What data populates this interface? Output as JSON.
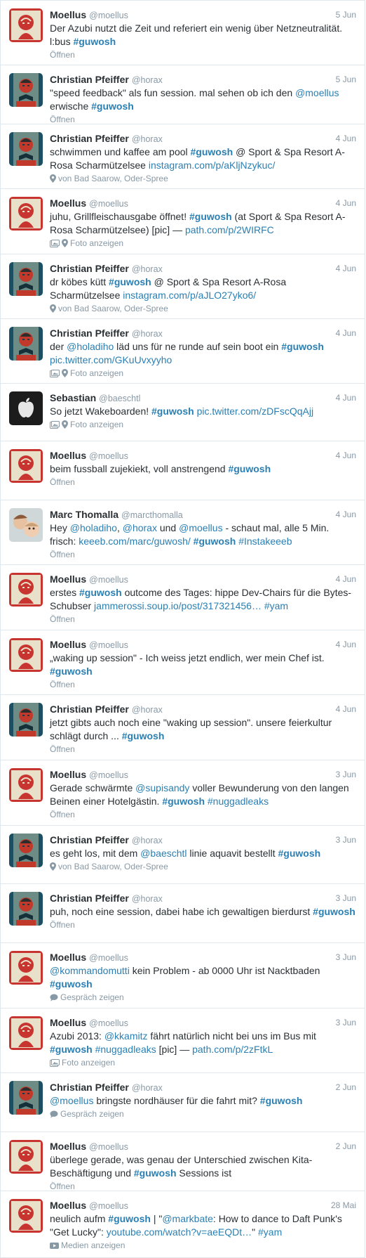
{
  "tweets": [
    {
      "name": "Moellus",
      "handle": "@moellus",
      "date": "5 Jun",
      "avatar": "obey-poster-avatar",
      "meta": {
        "icons": [],
        "label": "Öffnen"
      },
      "segments": [
        {
          "t": "text",
          "v": "Der Azubi nutzt die Zeit und referiert ein wenig über Netzneutralität. l:bus "
        },
        {
          "t": "hash",
          "v": "#guwosh"
        }
      ]
    },
    {
      "name": "Christian Pfeiffer",
      "handle": "@horax",
      "date": "5 Jun",
      "avatar": "bowtie-poster-avatar",
      "meta": {
        "icons": [],
        "label": "Öffnen"
      },
      "segments": [
        {
          "t": "text",
          "v": "\"speed feedback\" als fun session. mal sehen ob ich den "
        },
        {
          "t": "link",
          "v": "@moellus"
        },
        {
          "t": "text",
          "v": " erwische "
        },
        {
          "t": "hash",
          "v": "#guwosh"
        }
      ]
    },
    {
      "name": "Christian Pfeiffer",
      "handle": "@horax",
      "date": "4 Jun",
      "avatar": "bowtie-poster-avatar",
      "meta": {
        "icons": [
          "location-pin-icon"
        ],
        "label": "von Bad Saarow, Oder-Spree"
      },
      "segments": [
        {
          "t": "text",
          "v": "schwimmen und kaffee am pool "
        },
        {
          "t": "hash",
          "v": "#guwosh"
        },
        {
          "t": "text",
          "v": " @ Sport & Spa Resort A-Rosa Scharmützelsee "
        },
        {
          "t": "link",
          "v": "instagram.com/p/aKljNzykuc/"
        }
      ]
    },
    {
      "name": "Moellus",
      "handle": "@moellus",
      "date": "4 Jun",
      "avatar": "obey-poster-avatar",
      "meta": {
        "icons": [
          "photo-icon",
          "location-pin-icon"
        ],
        "label": "Foto anzeigen"
      },
      "segments": [
        {
          "t": "text",
          "v": "juhu, Grillfleischausgabe öffnet! "
        },
        {
          "t": "hash",
          "v": "#guwosh"
        },
        {
          "t": "text",
          "v": " (at Sport & Spa Resort A-Rosa Scharmützelsee) [pic] — "
        },
        {
          "t": "link",
          "v": "path.com/p/2WIRFC"
        }
      ]
    },
    {
      "name": "Christian Pfeiffer",
      "handle": "@horax",
      "date": "4 Jun",
      "avatar": "bowtie-poster-avatar",
      "meta": {
        "icons": [
          "location-pin-icon"
        ],
        "label": "von Bad Saarow, Oder-Spree"
      },
      "segments": [
        {
          "t": "text",
          "v": "dr köbes kütt "
        },
        {
          "t": "hash",
          "v": "#guwosh"
        },
        {
          "t": "text",
          "v": " @ Sport & Spa Resort A-Rosa Scharmützelsee "
        },
        {
          "t": "link",
          "v": "instagram.com/p/aJLO27yko6/"
        }
      ]
    },
    {
      "name": "Christian Pfeiffer",
      "handle": "@horax",
      "date": "4 Jun",
      "avatar": "bowtie-poster-avatar",
      "meta": {
        "icons": [
          "photo-icon",
          "location-pin-icon"
        ],
        "label": "Foto anzeigen"
      },
      "segments": [
        {
          "t": "text",
          "v": "der "
        },
        {
          "t": "link",
          "v": "@holadiho"
        },
        {
          "t": "text",
          "v": " läd uns für ne runde auf sein boot ein "
        },
        {
          "t": "hash",
          "v": "#guwosh"
        },
        {
          "t": "text",
          "v": " "
        },
        {
          "t": "link",
          "v": "pic.twitter.com/GKuUvxyyho"
        }
      ]
    },
    {
      "name": "Sebastian",
      "handle": "@baeschtl",
      "date": "4 Jun",
      "avatar": "apple-logo-avatar",
      "meta": {
        "icons": [
          "photo-icon",
          "location-pin-icon"
        ],
        "label": "Foto anzeigen"
      },
      "segments": [
        {
          "t": "text",
          "v": "So jetzt Wakeboarden! "
        },
        {
          "t": "hash",
          "v": "#guwosh"
        },
        {
          "t": "text",
          "v": " "
        },
        {
          "t": "link",
          "v": "pic.twitter.com/zDFscQqAjj"
        }
      ]
    },
    {
      "name": "Moellus",
      "handle": "@moellus",
      "date": "4 Jun",
      "avatar": "obey-poster-avatar",
      "meta": {
        "icons": [],
        "label": "Öffnen"
      },
      "segments": [
        {
          "t": "text",
          "v": "beim fussball zujekiekt, voll anstrengend "
        },
        {
          "t": "hash",
          "v": "#guwosh"
        }
      ]
    },
    {
      "name": "Marc Thomalla",
      "handle": "@marcthomalla",
      "date": "4 Jun",
      "avatar": "family-photo-avatar",
      "meta": {
        "icons": [],
        "label": "Öffnen"
      },
      "segments": [
        {
          "t": "text",
          "v": "Hey "
        },
        {
          "t": "link",
          "v": "@holadiho"
        },
        {
          "t": "text",
          "v": ", "
        },
        {
          "t": "link",
          "v": "@horax"
        },
        {
          "t": "text",
          "v": " und "
        },
        {
          "t": "link",
          "v": "@moellus"
        },
        {
          "t": "text",
          "v": " - schaut mal, alle 5 Min. frisch: "
        },
        {
          "t": "link",
          "v": "keeeb.com/marc/guwosh/"
        },
        {
          "t": "text",
          "v": " "
        },
        {
          "t": "hash",
          "v": "#guwosh"
        },
        {
          "t": "text",
          "v": " "
        },
        {
          "t": "link",
          "v": "#Instakeeeb"
        }
      ]
    },
    {
      "name": "Moellus",
      "handle": "@moellus",
      "date": "4 Jun",
      "avatar": "obey-poster-avatar",
      "meta": {
        "icons": [],
        "label": "Öffnen"
      },
      "segments": [
        {
          "t": "text",
          "v": "erstes "
        },
        {
          "t": "hash",
          "v": "#guwosh"
        },
        {
          "t": "text",
          "v": " outcome des Tages: hippe Dev-Chairs für die Bytes-Schubser "
        },
        {
          "t": "link",
          "v": "jammerossi.soup.io/post/317321456…"
        },
        {
          "t": "text",
          "v": " "
        },
        {
          "t": "link",
          "v": "#yam"
        }
      ]
    },
    {
      "name": "Moellus",
      "handle": "@moellus",
      "date": "4 Jun",
      "avatar": "obey-poster-avatar",
      "meta": {
        "icons": [],
        "label": "Öffnen"
      },
      "segments": [
        {
          "t": "text",
          "v": "„waking up session\" - Ich weiss jetzt endlich, wer mein Chef ist. "
        },
        {
          "t": "hash",
          "v": "#guwosh"
        }
      ]
    },
    {
      "name": "Christian Pfeiffer",
      "handle": "@horax",
      "date": "4 Jun",
      "avatar": "bowtie-poster-avatar",
      "meta": {
        "icons": [],
        "label": "Öffnen"
      },
      "segments": [
        {
          "t": "text",
          "v": "jetzt gibts auch noch eine \"waking up session\". unsere feierkultur schlägt durch ... "
        },
        {
          "t": "hash",
          "v": "#guwosh"
        }
      ]
    },
    {
      "name": "Moellus",
      "handle": "@moellus",
      "date": "3 Jun",
      "avatar": "obey-poster-avatar",
      "meta": {
        "icons": [],
        "label": "Öffnen"
      },
      "segments": [
        {
          "t": "text",
          "v": "Gerade schwärmte "
        },
        {
          "t": "link",
          "v": "@supisandy"
        },
        {
          "t": "text",
          "v": " voller Bewunderung von den langen Beinen einer Hotelgästin. "
        },
        {
          "t": "hash",
          "v": "#guwosh"
        },
        {
          "t": "text",
          "v": " "
        },
        {
          "t": "link",
          "v": "#nuggadleaks"
        }
      ]
    },
    {
      "name": "Christian Pfeiffer",
      "handle": "@horax",
      "date": "3 Jun",
      "avatar": "bowtie-poster-avatar",
      "meta": {
        "icons": [
          "location-pin-icon"
        ],
        "label": "von Bad Saarow, Oder-Spree"
      },
      "segments": [
        {
          "t": "text",
          "v": "es geht los, mit dem "
        },
        {
          "t": "link",
          "v": "@baeschtl"
        },
        {
          "t": "text",
          "v": " linie aquavit bestellt "
        },
        {
          "t": "hash",
          "v": "#guwosh"
        }
      ]
    },
    {
      "name": "Christian Pfeiffer",
      "handle": "@horax",
      "date": "3 Jun",
      "avatar": "bowtie-poster-avatar",
      "meta": {
        "icons": [],
        "label": "Öffnen"
      },
      "segments": [
        {
          "t": "text",
          "v": "puh, noch eine session, dabei habe ich gewaltigen bierdurst "
        },
        {
          "t": "hash",
          "v": "#guwosh"
        }
      ]
    },
    {
      "name": "Moellus",
      "handle": "@moellus",
      "date": "3 Jun",
      "avatar": "obey-poster-avatar",
      "meta": {
        "icons": [
          "speech-bubble-icon"
        ],
        "label": "Gespräch zeigen"
      },
      "segments": [
        {
          "t": "link",
          "v": "@kommandomutti"
        },
        {
          "t": "text",
          "v": " kein Problem - ab 0000 Uhr ist Nacktbaden "
        },
        {
          "t": "hash",
          "v": "#guwosh"
        }
      ]
    },
    {
      "name": "Moellus",
      "handle": "@moellus",
      "date": "3 Jun",
      "avatar": "obey-poster-avatar",
      "meta": {
        "icons": [
          "photo-icon"
        ],
        "label": "Foto anzeigen"
      },
      "segments": [
        {
          "t": "text",
          "v": "Azubi 2013: "
        },
        {
          "t": "link",
          "v": "@kkamitz"
        },
        {
          "t": "text",
          "v": " fährt natürlich nicht bei uns im Bus mit "
        },
        {
          "t": "hash",
          "v": "#guwosh"
        },
        {
          "t": "text",
          "v": " "
        },
        {
          "t": "link",
          "v": "#nuggadleaks"
        },
        {
          "t": "text",
          "v": " [pic] — "
        },
        {
          "t": "link",
          "v": "path.com/p/2zFtkL"
        }
      ]
    },
    {
      "name": "Christian Pfeiffer",
      "handle": "@horax",
      "date": "2 Jun",
      "avatar": "bowtie-poster-avatar",
      "meta": {
        "icons": [
          "speech-bubble-icon"
        ],
        "label": "Gespräch zeigen"
      },
      "segments": [
        {
          "t": "link",
          "v": "@moellus"
        },
        {
          "t": "text",
          "v": " bringste nordhäuser für die fahrt mit? "
        },
        {
          "t": "hash",
          "v": "#guwosh"
        }
      ]
    },
    {
      "name": "Moellus",
      "handle": "@moellus",
      "date": "2 Jun",
      "avatar": "obey-poster-avatar",
      "meta": {
        "icons": [],
        "label": "Öffnen"
      },
      "segments": [
        {
          "t": "text",
          "v": "überlege gerade, was genau der Unterschied zwischen Kita-Beschäftigung und "
        },
        {
          "t": "hash",
          "v": "#guwosh"
        },
        {
          "t": "text",
          "v": " Sessions ist"
        }
      ]
    },
    {
      "name": "Moellus",
      "handle": "@moellus",
      "date": "28 Mai",
      "avatar": "obey-poster-avatar",
      "meta": {
        "icons": [
          "video-play-icon"
        ],
        "label": "Medien anzeigen"
      },
      "segments": [
        {
          "t": "text",
          "v": "neulich aufm "
        },
        {
          "t": "hash",
          "v": "#guwosh"
        },
        {
          "t": "text",
          "v": " | \""
        },
        {
          "t": "link",
          "v": "@markbate"
        },
        {
          "t": "text",
          "v": ": How to dance to Daft Punk's \"Get Lucky\": "
        },
        {
          "t": "link",
          "v": "youtube.com/watch?v=aeEQDt…"
        },
        {
          "t": "text",
          "v": "\" "
        },
        {
          "t": "link",
          "v": "#yam"
        }
      ]
    }
  ]
}
